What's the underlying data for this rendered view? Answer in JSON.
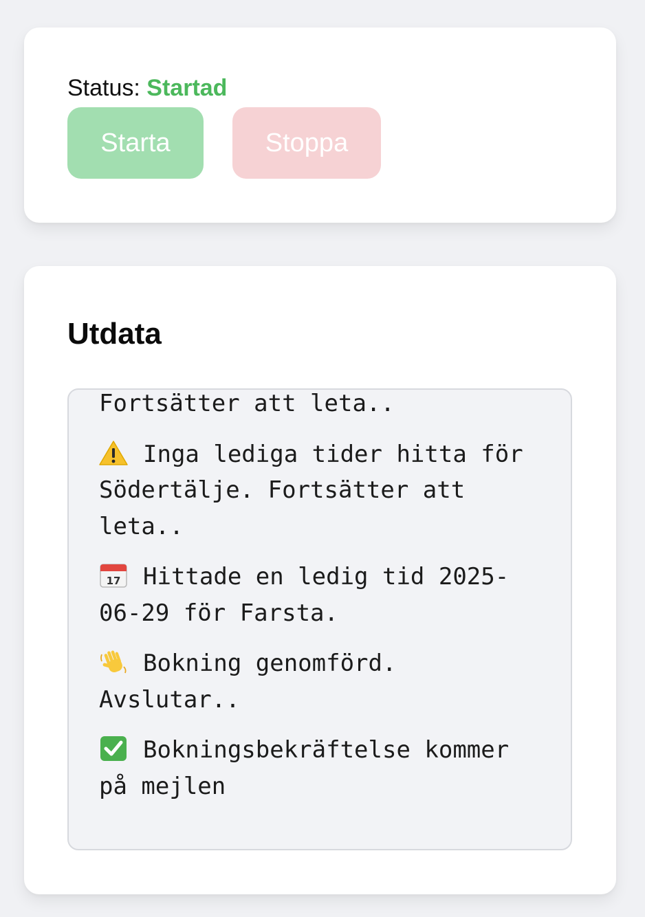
{
  "control": {
    "status_label": "Status:",
    "status_value": "Startad",
    "start_label": "Starta",
    "stop_label": "Stoppa"
  },
  "output": {
    "title": "Utdata",
    "lines": [
      {
        "icon": "",
        "text": "Fortsätter att leta.."
      },
      {
        "icon": "warning-icon",
        "text": "Inga lediga tider hitta för Södertälje. Fortsätter att leta.."
      },
      {
        "icon": "calendar-icon",
        "text": "Hittade en ledig tid 2025-06-29 för Farsta."
      },
      {
        "icon": "waving-hand-icon",
        "text": "Bokning genomförd. Avslutar.."
      },
      {
        "icon": "check-mark-icon",
        "text": "Bokningsbekräftelse kommer på mejlen"
      }
    ]
  },
  "colors": {
    "status_green": "#4cb85c",
    "start_button": "#a2deb0",
    "stop_button": "#f6d2d4"
  }
}
